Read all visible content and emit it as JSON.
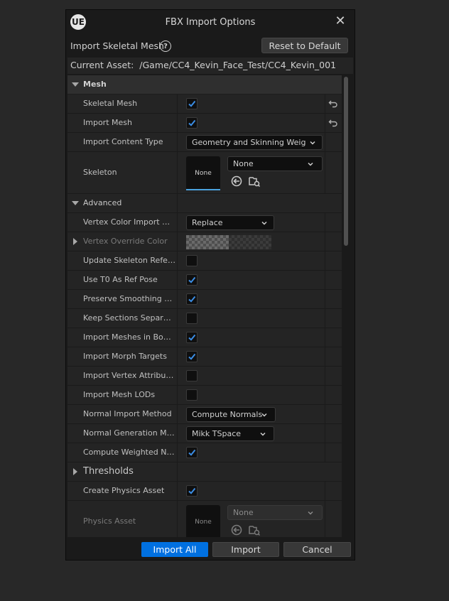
{
  "dialog": {
    "title": "FBX Import Options",
    "logo": "UE",
    "close_glyph": "✕"
  },
  "header": {
    "section_label": "Import Skeletal Mesh",
    "reset_label": "Reset to Default",
    "current_asset_label": "Current Asset:",
    "current_asset_path": "/Game/CC4_Kevin_Face_Test/CC4_Kevin_001"
  },
  "mesh": {
    "category_label": "Mesh",
    "skeletal_mesh_label": "Skeletal Mesh",
    "skeletal_mesh_checked": true,
    "import_mesh_label": "Import Mesh",
    "import_mesh_checked": true,
    "import_content_type_label": "Import Content Type",
    "import_content_type_value": "Geometry and Skinning Weights",
    "skeleton_label": "Skeleton",
    "skeleton_thumb_text": "None",
    "skeleton_value": "None"
  },
  "advanced": {
    "label": "Advanced",
    "vertex_color_import_label": "Vertex Color Import Opti...",
    "vertex_color_import_value": "Replace",
    "vertex_override_color_label": "Vertex Override Color",
    "update_skeleton_label": "Update Skeleton Refere...",
    "update_skeleton_checked": false,
    "use_t0_label": "Use T0 As Ref Pose",
    "use_t0_checked": true,
    "preserve_smoothing_label": "Preserve Smoothing Gro...",
    "preserve_smoothing_checked": true,
    "keep_sections_label": "Keep Sections Separate",
    "keep_sections_checked": false,
    "import_meshes_bone_label": "Import Meshes in Bone...",
    "import_meshes_bone_checked": true,
    "import_morph_label": "Import Morph Targets",
    "import_morph_checked": true,
    "import_vertex_attr_label": "Import Vertex Attributes",
    "import_vertex_attr_checked": false,
    "import_mesh_lods_label": "Import Mesh LODs",
    "import_mesh_lods_checked": false,
    "normal_import_label": "Normal Import Method",
    "normal_import_value": "Compute Normals",
    "normal_gen_label": "Normal Generation Met...",
    "normal_gen_value": "Mikk TSpace",
    "compute_weighted_label": "Compute Weighted Nor...",
    "compute_weighted_checked": true
  },
  "thresholds": {
    "label": "Thresholds"
  },
  "physics": {
    "create_physics_label": "Create Physics Asset",
    "create_physics_checked": true,
    "physics_asset_label": "Physics Asset",
    "physics_thumb_text": "None",
    "physics_asset_value": "None"
  },
  "footer": {
    "import_all_label": "Import All",
    "import_label": "Import",
    "cancel_label": "Cancel"
  },
  "colors": {
    "accent": "#0070e0",
    "check": "#3b8ee6",
    "background": "#282828",
    "panel": "#1a1a1a"
  }
}
